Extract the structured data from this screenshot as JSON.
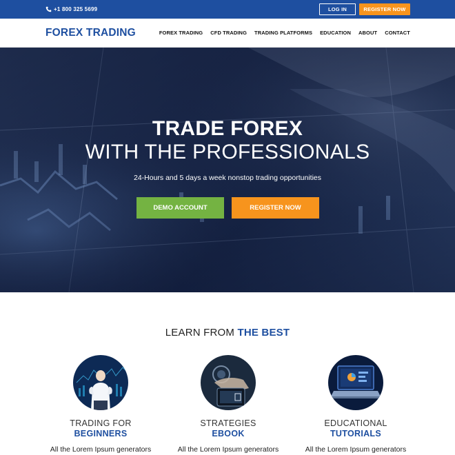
{
  "topbar": {
    "phone": "+1 800 325 5699",
    "login_label": "LOG IN",
    "register_label": "REGISTER NOW"
  },
  "header": {
    "logo": "FOREX TRADING",
    "nav": [
      "FOREX TRADING",
      "CFD TRADING",
      "TRADING PLATFORMS",
      "EDUCATION",
      "ABOUT",
      "CONTACT"
    ]
  },
  "hero": {
    "title_line1": "TRADE FOREX",
    "title_line2": "WITH THE PROFESSIONALS",
    "subtitle": "24-Hours and 5 days a week nonstop trading opportunities",
    "demo_label": "DEMO ACCOUNT",
    "register_label": "REGISTER NOW"
  },
  "learn": {
    "title_prefix": "LEARN FROM ",
    "title_accent": "THE BEST",
    "features": [
      {
        "line1": "TRADING FOR",
        "line2": "BEGINNERS",
        "desc": "All the Lorem Ipsum generators",
        "icon": "businessman-chart-icon"
      },
      {
        "line1": "STRATEGIES",
        "line2": "EBOOK",
        "desc": "All the Lorem Ipsum generators",
        "icon": "tablet-hand-icon"
      },
      {
        "line1": "EDUCATIONAL",
        "line2": "TUTORIALS",
        "desc": "All the Lorem Ipsum generators",
        "icon": "laptop-dashboard-icon"
      }
    ]
  },
  "colors": {
    "brand_blue": "#1e4fa0",
    "accent_orange": "#f7941d",
    "accent_green": "#74b342"
  }
}
